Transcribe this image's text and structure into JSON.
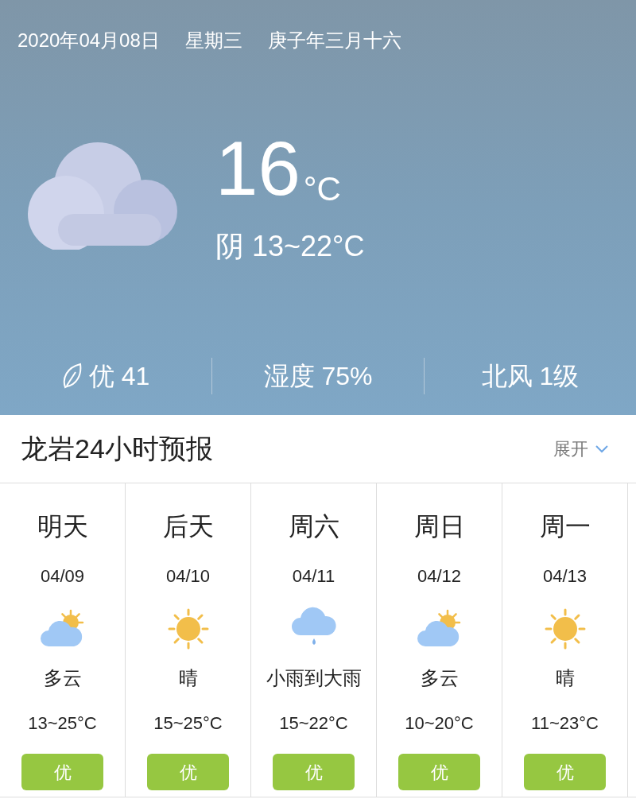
{
  "header": {
    "date": "2020年04月08日",
    "weekday": "星期三",
    "lunar": "庚子年三月十六",
    "temperature": "16",
    "unit": "°C",
    "condition": "阴 13~22°C",
    "stats": [
      {
        "kind": "aqi",
        "text": "优 41"
      },
      {
        "kind": "plain",
        "text": "湿度 75%"
      },
      {
        "kind": "plain",
        "text": "北风 1级"
      }
    ]
  },
  "forecast": {
    "title": "龙岩24小时预报",
    "expand": "展开",
    "days": [
      {
        "day": "明天",
        "date": "04/09",
        "kind": "partly_cloudy",
        "condition": "多云",
        "temps": "13~25°C",
        "aqi": "优"
      },
      {
        "day": "后天",
        "date": "04/10",
        "kind": "sunny",
        "condition": "晴",
        "temps": "15~25°C",
        "aqi": "优"
      },
      {
        "day": "周六",
        "date": "04/11",
        "kind": "rain",
        "condition": "小雨到大雨",
        "temps": "15~22°C",
        "aqi": "优"
      },
      {
        "day": "周日",
        "date": "04/12",
        "kind": "partly_cloudy",
        "condition": "多云",
        "temps": "10~20°C",
        "aqi": "优"
      },
      {
        "day": "周一",
        "date": "04/13",
        "kind": "sunny",
        "condition": "晴",
        "temps": "11~23°C",
        "aqi": "优"
      }
    ]
  }
}
